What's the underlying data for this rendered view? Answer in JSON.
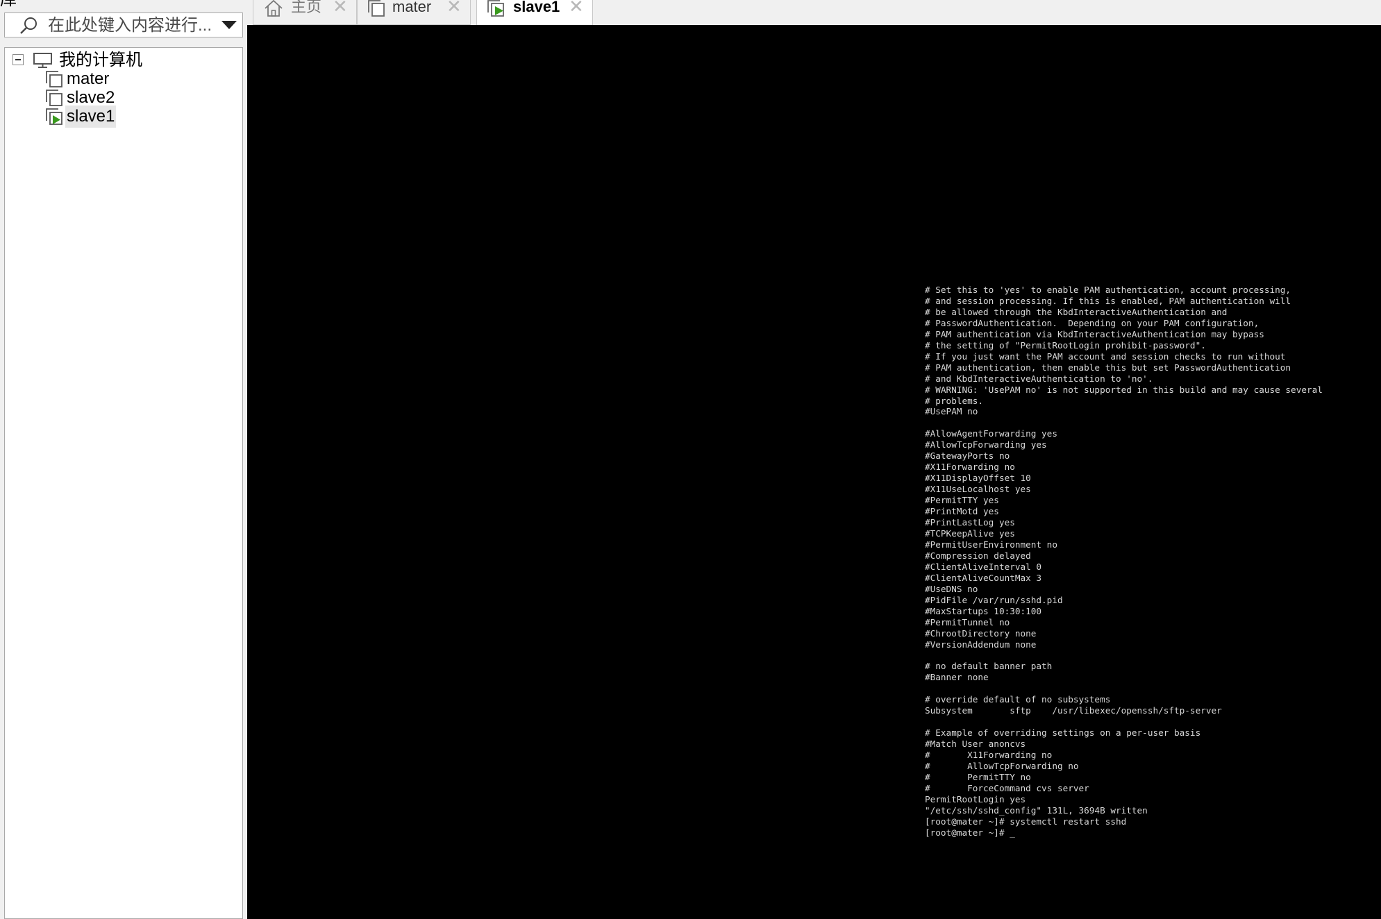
{
  "library": {
    "header_fragment": "库",
    "search": {
      "placeholder": "在此处键入内容进行..."
    },
    "tree": {
      "root": {
        "label": "我的计算机",
        "expanded": true,
        "icon": "computer-icon"
      },
      "items": [
        {
          "label": "mater",
          "icon": "vm-icon",
          "state": "stopped",
          "selected": false
        },
        {
          "label": "slave2",
          "icon": "vm-icon",
          "state": "stopped",
          "selected": false
        },
        {
          "label": "slave1",
          "icon": "vm-running-icon",
          "state": "running",
          "selected": true
        }
      ]
    }
  },
  "tabs": [
    {
      "label": "主页",
      "icon": "home-icon",
      "active": false
    },
    {
      "label": "mater",
      "icon": "vm-icon",
      "active": false
    },
    {
      "label": "slave1",
      "icon": "vm-running-icon",
      "active": true
    }
  ],
  "console": {
    "lines": [
      "# Set this to 'yes' to enable PAM authentication, account processing,",
      "# and session processing. If this is enabled, PAM authentication will",
      "# be allowed through the KbdInteractiveAuthentication and",
      "# PasswordAuthentication.  Depending on your PAM configuration,",
      "# PAM authentication via KbdInteractiveAuthentication may bypass",
      "# the setting of \"PermitRootLogin prohibit-password\".",
      "# If you just want the PAM account and session checks to run without",
      "# PAM authentication, then enable this but set PasswordAuthentication",
      "# and KbdInteractiveAuthentication to 'no'.",
      "# WARNING: 'UsePAM no' is not supported in this build and may cause several",
      "# problems.",
      "#UsePAM no",
      "",
      "#AllowAgentForwarding yes",
      "#AllowTcpForwarding yes",
      "#GatewayPorts no",
      "#X11Forwarding no",
      "#X11DisplayOffset 10",
      "#X11UseLocalhost yes",
      "#PermitTTY yes",
      "#PrintMotd yes",
      "#PrintLastLog yes",
      "#TCPKeepAlive yes",
      "#PermitUserEnvironment no",
      "#Compression delayed",
      "#ClientAliveInterval 0",
      "#ClientAliveCountMax 3",
      "#UseDNS no",
      "#PidFile /var/run/sshd.pid",
      "#MaxStartups 10:30:100",
      "#PermitTunnel no",
      "#ChrootDirectory none",
      "#VersionAddendum none",
      "",
      "# no default banner path",
      "#Banner none",
      "",
      "# override default of no subsystems",
      "Subsystem       sftp    /usr/libexec/openssh/sftp-server",
      "",
      "# Example of overriding settings on a per-user basis",
      "#Match User anoncvs",
      "#       X11Forwarding no",
      "#       AllowTcpForwarding no",
      "#       PermitTTY no",
      "#       ForceCommand cvs server",
      "PermitRootLogin yes",
      "\"/etc/ssh/sshd_config\" 131L, 3694B written",
      "[root@mater ~]# systemctl restart sshd",
      "[root@mater ~]# _"
    ]
  }
}
